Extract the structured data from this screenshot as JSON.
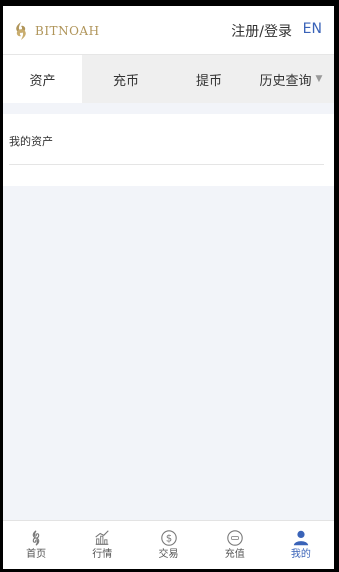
{
  "header": {
    "brand": "BITNOAH",
    "login_label": "注册/登录",
    "language_label": "EN"
  },
  "tabs": [
    {
      "label": "资产",
      "active": true
    },
    {
      "label": "充币",
      "active": false
    },
    {
      "label": "提币",
      "active": false
    },
    {
      "label": "历史查询",
      "active": false,
      "has_dropdown": true
    }
  ],
  "assets": {
    "title": "我的资产"
  },
  "bottom_nav": [
    {
      "label": "首页",
      "icon": "home-logo-icon"
    },
    {
      "label": "行情",
      "icon": "chart-icon"
    },
    {
      "label": "交易",
      "icon": "dollar-icon"
    },
    {
      "label": "充值",
      "icon": "recharge-icon"
    },
    {
      "label": "我的",
      "icon": "user-icon",
      "active": true
    }
  ],
  "colors": {
    "brand_gold": "#b0955a",
    "accent_blue": "#3a63b8",
    "page_bg": "#f2f4f9"
  }
}
